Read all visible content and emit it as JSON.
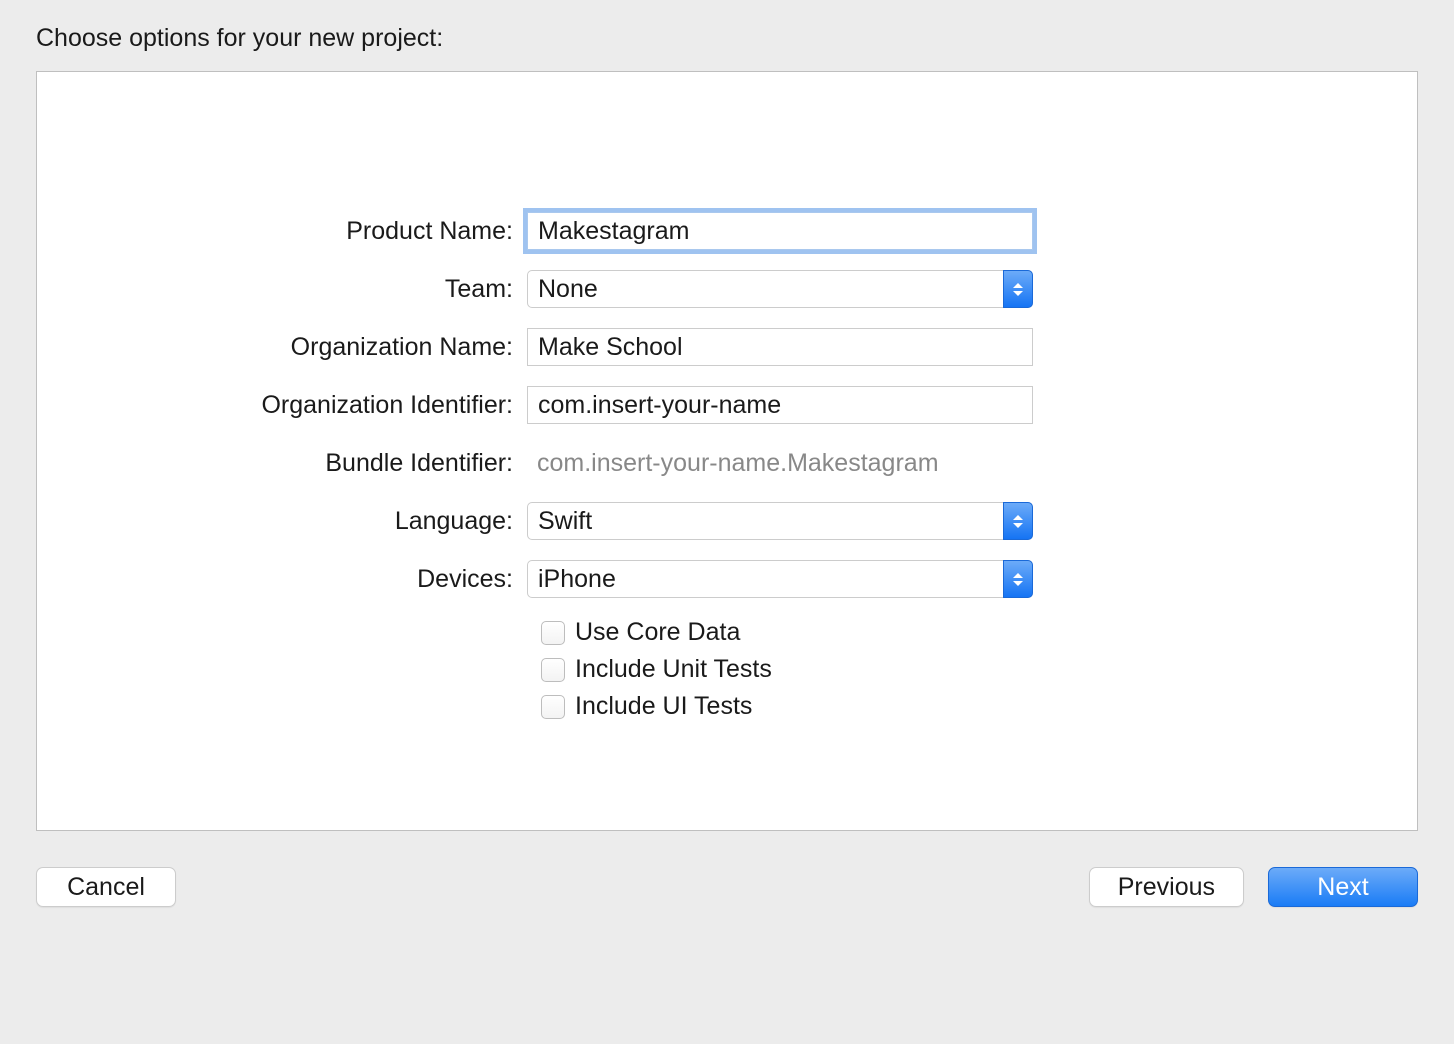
{
  "dialog": {
    "title": "Choose options for your new project:"
  },
  "form": {
    "productName": {
      "label": "Product Name:",
      "value": "Makestagram"
    },
    "team": {
      "label": "Team:",
      "value": "None"
    },
    "orgName": {
      "label": "Organization Name:",
      "value": "Make School"
    },
    "orgIdentifier": {
      "label": "Organization Identifier:",
      "value": "com.insert-your-name"
    },
    "bundleIdentifier": {
      "label": "Bundle Identifier:",
      "value": "com.insert-your-name.Makestagram"
    },
    "language": {
      "label": "Language:",
      "value": "Swift"
    },
    "devices": {
      "label": "Devices:",
      "value": "iPhone"
    },
    "checkboxes": {
      "useCoreData": {
        "label": "Use Core Data",
        "checked": false
      },
      "includeUnitTests": {
        "label": "Include Unit Tests",
        "checked": false
      },
      "includeUITests": {
        "label": "Include UI Tests",
        "checked": false
      }
    }
  },
  "buttons": {
    "cancel": "Cancel",
    "previous": "Previous",
    "next": "Next"
  }
}
